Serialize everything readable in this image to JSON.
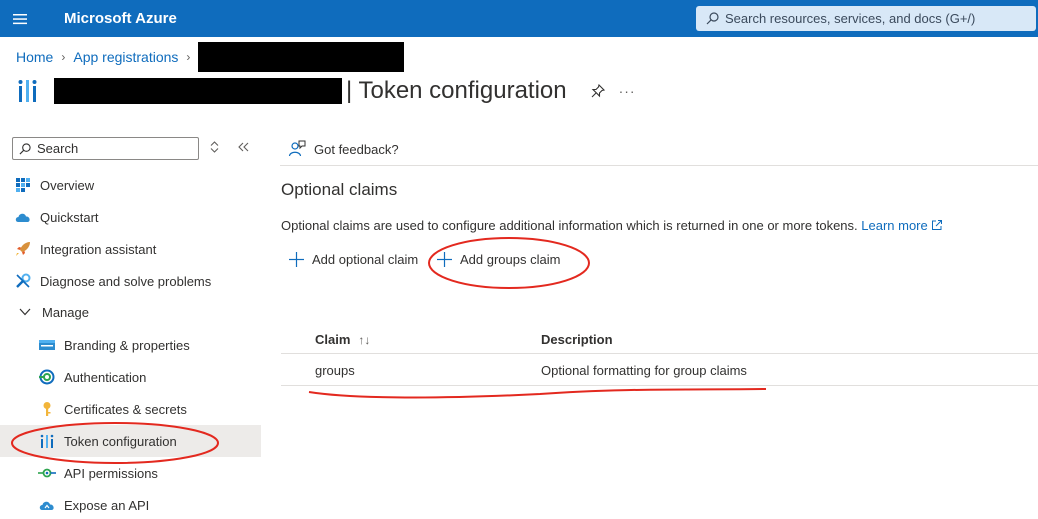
{
  "topbar": {
    "brand": "Microsoft Azure",
    "search_placeholder": "Search resources, services, and docs (G+/)"
  },
  "breadcrumb": {
    "home": "Home",
    "app_registrations": "App registrations"
  },
  "page": {
    "title": "| Token configuration",
    "more": "···"
  },
  "sidebar": {
    "search_placeholder": "Search",
    "items": [
      {
        "label": "Overview",
        "icon": "overview-icon"
      },
      {
        "label": "Quickstart",
        "icon": "cloud-icon"
      },
      {
        "label": "Integration assistant",
        "icon": "rocket-icon"
      },
      {
        "label": "Diagnose and solve problems",
        "icon": "wrench-icon"
      },
      {
        "label": "Manage",
        "icon": "chevron-down-icon"
      },
      {
        "label": "Branding & properties",
        "icon": "branding-icon"
      },
      {
        "label": "Authentication",
        "icon": "authentication-icon"
      },
      {
        "label": "Certificates & secrets",
        "icon": "key-icon"
      },
      {
        "label": "Token configuration",
        "icon": "token-icon",
        "selected": true
      },
      {
        "label": "API permissions",
        "icon": "api-permissions-icon"
      },
      {
        "label": "Expose an API",
        "icon": "cloud-icon"
      }
    ]
  },
  "main": {
    "feedback": "Got feedback?",
    "section_title": "Optional claims",
    "description": "Optional claims are used to configure additional information which is returned in one or more tokens.",
    "learn_more": "Learn more",
    "add_optional_claim": "Add optional claim",
    "add_groups_claim": "Add groups claim",
    "table": {
      "headers": [
        "Claim",
        "Description"
      ],
      "rows": [
        {
          "claim": "groups",
          "description": "Optional formatting for group claims"
        }
      ]
    }
  },
  "colors": {
    "topbar": "#0f6cbd",
    "link": "#0f6cbd",
    "annotation": "#e3291f",
    "selected_bg": "#edebe9"
  }
}
